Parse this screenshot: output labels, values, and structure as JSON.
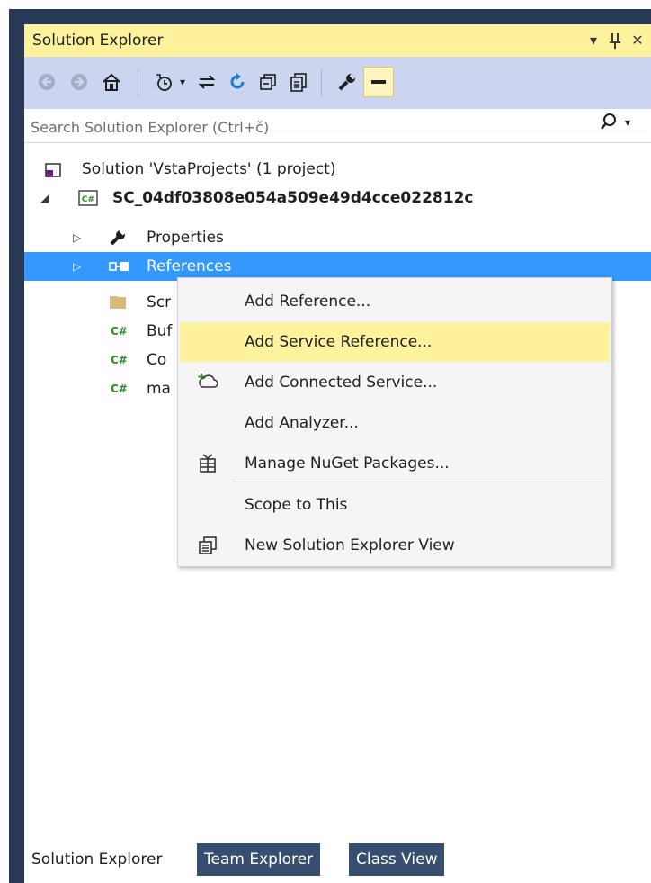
{
  "window": {
    "title": "Solution Explorer",
    "dropdown_glyph": "▾",
    "pin_glyph": "ᚹ",
    "close_glyph": "✕"
  },
  "toolbar": {
    "icons": [
      "back-icon",
      "forward-icon",
      "home-icon",
      "pending-changes-filter-icon",
      "dropdown-icon",
      "sync-icon",
      "refresh-icon",
      "collapse-all-icon",
      "show-all-files-icon",
      "properties-icon",
      "preview-icon"
    ]
  },
  "search": {
    "placeholder": "Search Solution Explorer (Ctrl+č)",
    "search_glyph": "⌕",
    "dropdown_glyph": "▾"
  },
  "tree": {
    "solution": "Solution 'VstaProjects' (1 project)",
    "project": "SC_04df03808e054a509e49d4cce022812c",
    "project_badge": "C#",
    "properties": "Properties",
    "references": "References",
    "scripts": "Scr",
    "file1": "Buf",
    "file2": "Co",
    "file3": "ma",
    "cs_badge": "C#"
  },
  "context_menu": {
    "items": [
      {
        "label": "Add Reference..."
      },
      {
        "label": "Add Service Reference..."
      },
      {
        "label": "Add Connected Service..."
      },
      {
        "label": "Add Analyzer..."
      },
      {
        "label": "Manage NuGet Packages..."
      },
      {
        "label": "Scope to This"
      },
      {
        "label": "New Solution Explorer View"
      }
    ],
    "highlighted_index": 1
  },
  "tabs": [
    {
      "label": "Solution Explorer"
    },
    {
      "label": "Team Explorer"
    },
    {
      "label": "Class View"
    }
  ],
  "colors": {
    "frame": "#293955",
    "title_active": "#fff29d",
    "toolbar": "#ccd5f0",
    "selection": "#3399ff",
    "menu_highlight": "#fff29d"
  }
}
